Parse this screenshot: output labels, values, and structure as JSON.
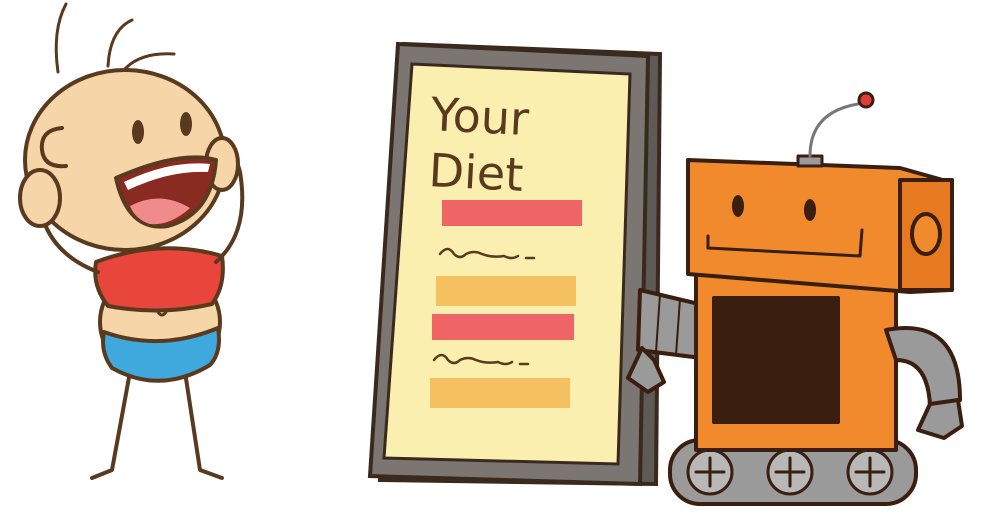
{
  "board": {
    "title_line1": "Your",
    "title_line2": "Diet"
  },
  "colors": {
    "outline": "#5a3a1e",
    "board_frame": "#7b7672",
    "board_paper": "#fbefb0",
    "bar_red": "#ef6464",
    "bar_orange": "#f5c060",
    "robot_orange": "#f08a2c",
    "robot_dark": "#3a1e10",
    "robot_gray": "#9a9a9a",
    "antenna_tip": "#e23b3b",
    "kid_skin": "#f6d6a8",
    "kid_shirt": "#e8463a",
    "kid_shorts": "#3fa9dd"
  },
  "characters": {
    "kid": "excited-boy",
    "robot": "orange-robot"
  },
  "icons": {
    "board": "diet-board-icon",
    "robot": "robot-icon"
  }
}
